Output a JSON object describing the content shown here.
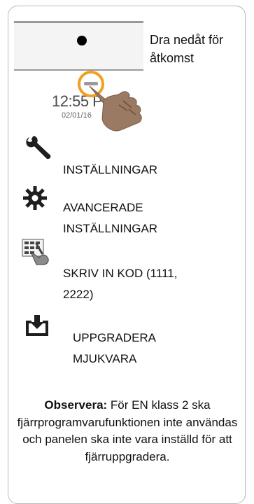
{
  "screen": {
    "hint": "Dra nedåt för åtkomst",
    "clock_time": "12:55 P",
    "clock_date": "02/01/16"
  },
  "menu": {
    "items": [
      {
        "icon": "wrench-icon",
        "label": "INSTÄLLNINGAR"
      },
      {
        "icon": "gear-icon",
        "label": "AVANCERADE INSTÄLLNINGAR"
      },
      {
        "icon": "keypad-hand-icon",
        "label": "SKRIV IN KOD (1111, 2222)"
      },
      {
        "icon": "download-tray-icon",
        "label": "UPPGRADERA MJUKVARA"
      }
    ]
  },
  "note": {
    "label": "Observera:",
    "text": "För EN klass 2 ska fjärrprogramvarufunktionen inte användas och panelen ska inte vara inställd för att fjärruppgradera."
  },
  "colors": {
    "ring": "#f0a020",
    "hand": "#9a7a63",
    "icon": "#2a2a2a"
  }
}
